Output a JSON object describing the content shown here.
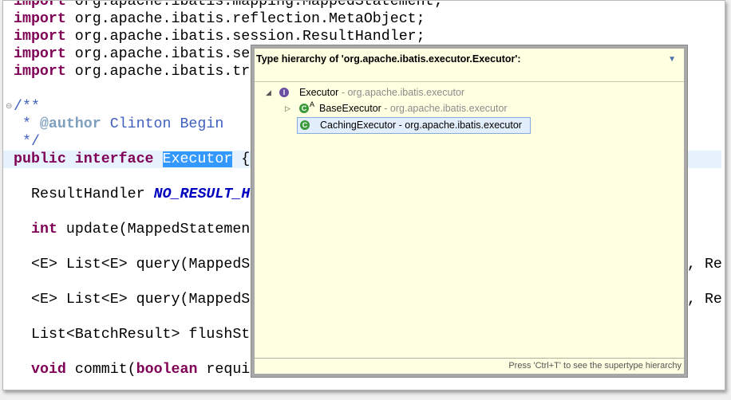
{
  "code_lines": {
    "l1": {
      "kw": "import",
      "rest": " org.apache.ibatis.reflection.MetaObject;"
    },
    "l2": {
      "kw": "import",
      "rest": " org.apache.ibatis.session.ResultHandler;"
    },
    "l3": {
      "kw": "import",
      "rest": " org.apache.ibatis.se"
    },
    "l4": {
      "kw": "import",
      "rest": " org.apache.ibatis.tr"
    },
    "c1": "/**",
    "c2a": " * ",
    "c2tag": "@author",
    "c2b": " Clinton Begin",
    "c3": " */",
    "decl": {
      "kw": "public interface",
      "name": "Executor",
      "rest": " {"
    },
    "f1": {
      "type": "ResultHandler ",
      "const": "NO_RESULT_H"
    },
    "m1": {
      "kw": "int",
      "rest": " update(MappedStatemen"
    },
    "m2": {
      "text": "<E> List<E> query(MappedS",
      "tail": ", Re"
    },
    "m3": {
      "text": "<E> List<E> query(MappedS",
      "tail": ", Re"
    },
    "m4": {
      "text": "List<BatchResult> flushSt"
    },
    "m5": {
      "kw": "void",
      "mid": " commit(",
      "kw2": "boolean",
      "rest": " requi"
    }
  },
  "popup": {
    "title": "Type hierarchy of 'org.apache.ibatis.executor.Executor':",
    "menu_icon": "triangle-down",
    "items": [
      {
        "name": "Executor",
        "pkg": " - org.apache.ibatis.executor",
        "icon": "interface-icon"
      },
      {
        "name": "BaseExecutor",
        "pkg": " - org.apache.ibatis.executor",
        "icon": "abstract-class-icon",
        "badge": "A"
      },
      {
        "name": "CachingExecutor",
        "pkg": " - org.apache.ibatis.executor",
        "icon": "class-icon"
      }
    ],
    "hint": "Press 'Ctrl+T' to see the supertype hierarchy"
  }
}
